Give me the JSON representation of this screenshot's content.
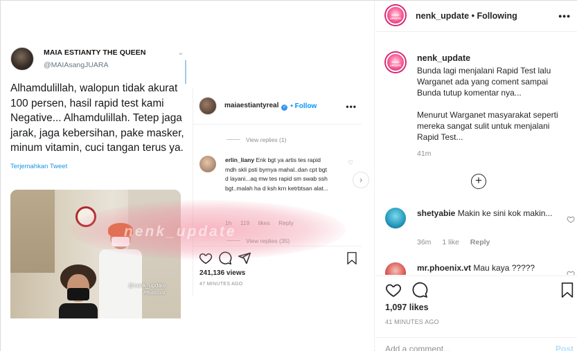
{
  "tweet": {
    "name": "MAIA ESTIANTY THE QUEEN",
    "handle": "@MAIAsangJUARA",
    "text": "Alhamdulillah, walopun tidak akurat 100 persen, hasil rapid test kami Negative... Alhamdulillah. Tetep jaga jarak, jaga kebersihan, pake masker, minum vitamin, cuci tangan terus ya.",
    "translate": "Terjemahkan Tweet"
  },
  "photo": {
    "watermark": "@nenk_update",
    "watermark2": "PhotoGrid"
  },
  "overlay_watermark": "nenk_update",
  "embedded_ig": {
    "username": "maiaestiantyreal",
    "follow": "• Follow",
    "view_replies_1": "View replies (1)",
    "comment_user": "erlin_liany",
    "comment_text": "Enk bgt ya artis tes rapid mdh skli psti byrnya mahal..dan cpt bgt d layani...aq mw tes rapid sm swab ssh bgt..malah ha d ksh krn ketrbtsan alat...",
    "comment_meta": "1h 119 likes Reply",
    "view_replies_2": "View replies (35)",
    "views": "241,136 views",
    "time": "47 MINUTES AGO"
  },
  "header": {
    "username": "nenk_update",
    "following": "• Following"
  },
  "caption": {
    "username": "nenk_update",
    "text": "Bunda lagi menjalani Rapid Test lalu Warganet ada yang coment sampai Bunda tutup komentar nya...\n\nMenurut Warganet masyarakat seperti mereka sangat sulit untuk menjalani Rapid Test...",
    "time": "41m"
  },
  "comments": [
    {
      "user": "shetyabie",
      "text": "Makin ke sini kok makin...",
      "time": "36m",
      "likes": "1 like",
      "reply": "Reply"
    },
    {
      "user": "mr.phoenix.vt",
      "text": "Mau kaya ?????"
    }
  ],
  "footer": {
    "likes": "1,097 likes",
    "posted": "41 MINUTES AGO",
    "comment_placeholder": "Add a comment...",
    "post_label": "Post"
  },
  "colors": {
    "accent": "#0095f6",
    "ring": "#d62976",
    "muted": "#8e8e8e",
    "text": "#262626"
  },
  "icons": [
    "heart-icon",
    "comment-icon",
    "share-icon",
    "bookmark-icon",
    "more-icon",
    "plus-circle-icon",
    "chevron-right-icon",
    "verified-icon"
  ]
}
